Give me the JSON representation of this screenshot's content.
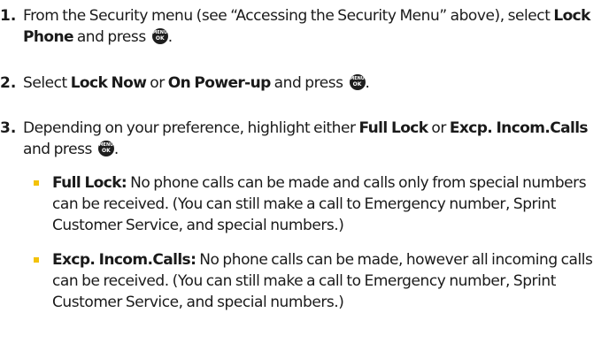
{
  "steps": [
    {
      "number": "1.",
      "pre": "From the Security menu (see “Accessing the Security Menu” above), select ",
      "bold1": "Lock Phone",
      "mid": " and press",
      "end": "."
    },
    {
      "number": "2.",
      "pre": "Select ",
      "bold1": "Lock Now",
      "mid1": " or ",
      "bold2": "On Power-up",
      "mid2": " and press",
      "end": "."
    },
    {
      "number": "3.",
      "pre": "Depending on your preference, highlight either ",
      "bold1": "Full Lock",
      "mid1": " or ",
      "bold2": "Excp. Incom.Calls",
      "mid2": " and press",
      "end": "."
    }
  ],
  "bullets": [
    {
      "term": "Full Lock:",
      "text": " No phone calls can be made and calls only from special numbers can be received. (You can still make a call to Emergency number, Sprint Customer Service, and special numbers.)"
    },
    {
      "term": "Excp. Incom.Calls:",
      "text": " No phone calls can be made, however all incoming calls can be received. (You can still make a call to Emergency number, Sprint Customer Service, and special numbers.)"
    }
  ],
  "menu_ok_key": {
    "line1": "MENU",
    "line2": "OK",
    "icon": "menu-ok-key-icon"
  },
  "colors": {
    "text": "#1a1a1a",
    "bullet_square": "#f3c20a",
    "key": "#1e1e1e"
  }
}
